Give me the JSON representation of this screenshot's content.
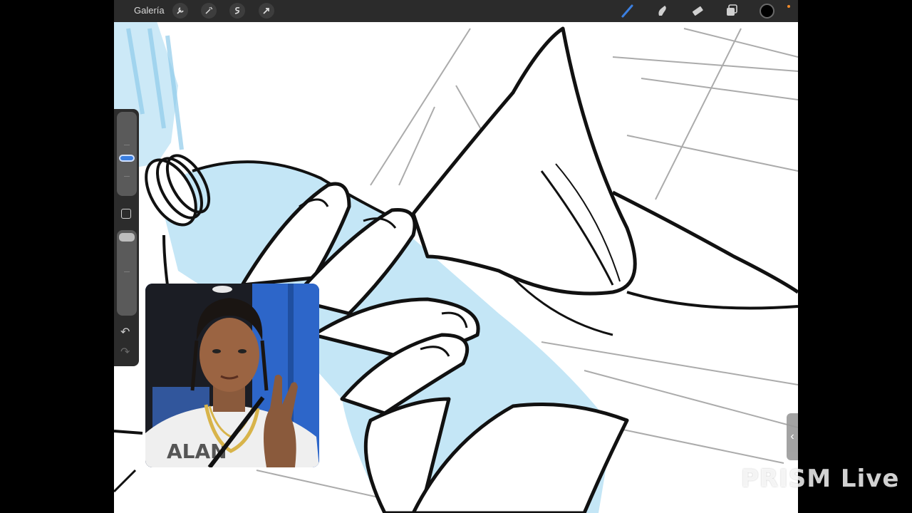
{
  "toolbar": {
    "gallery_label": "Galería",
    "left_tools": [
      "wrench-icon",
      "magic-wand-icon",
      "selection-s-icon",
      "transform-arrow-icon"
    ],
    "right_tools": [
      "brush-icon",
      "smudge-icon",
      "eraser-icon",
      "layers-icon"
    ],
    "active_tool": "brush-icon",
    "current_color": "#000000",
    "accent_color": "#3b7fe0"
  },
  "sidebar": {
    "undo_symbol": "↶",
    "redo_symbol": "↷"
  },
  "right_handle": {
    "symbol": "‹"
  },
  "watermark": {
    "text": "PRISM Live"
  }
}
